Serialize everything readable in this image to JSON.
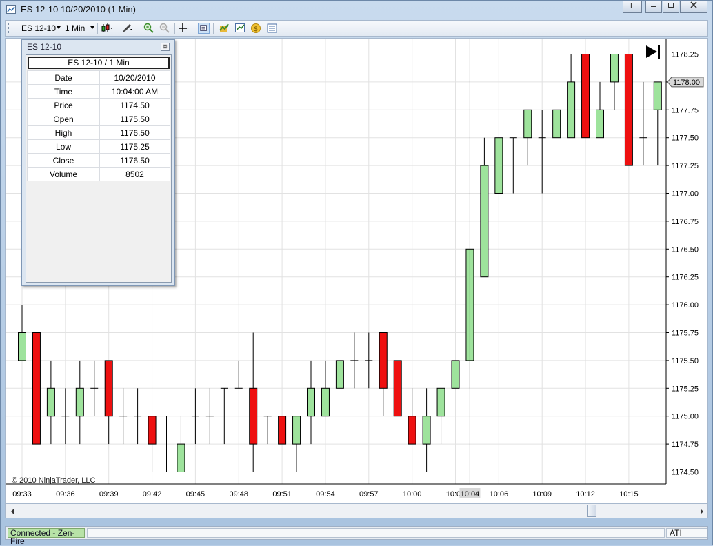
{
  "window": {
    "title": "ES 12-10  10/20/2010 (1 Min)",
    "min_label": "L",
    "buttons": [
      "minimize",
      "maximize",
      "close"
    ]
  },
  "toolbar": {
    "instrument": "ES 12-10",
    "period": "1 Min"
  },
  "data_box": {
    "title": "ES 12-10",
    "header": "ES 12-10 / 1 Min",
    "rows": [
      {
        "label": "Date",
        "value": "10/20/2010"
      },
      {
        "label": "Time",
        "value": "10:04:00 AM"
      },
      {
        "label": "Price",
        "value": "1174.50"
      },
      {
        "label": "Open",
        "value": "1175.50"
      },
      {
        "label": "High",
        "value": "1176.50"
      },
      {
        "label": "Low",
        "value": "1175.25"
      },
      {
        "label": "Close",
        "value": "1176.50"
      },
      {
        "label": "Volume",
        "value": "8502"
      }
    ]
  },
  "copyright": "© 2010 NinjaTrader, LLC",
  "status": {
    "connection": "Connected - Zen-Fire",
    "provider": "ATI"
  },
  "colors": {
    "up": "#9ee39c",
    "down": "#ee1010",
    "grid": "#e2e2e2",
    "current_price_bg": "#d8d8d8"
  },
  "chart_data": {
    "type": "candlestick",
    "instrument": "ES 12-10",
    "interval": "1 Min",
    "ylim": [
      1174.5,
      1178.25
    ],
    "yticks": [
      "1178.25",
      "1178.00",
      "1177.75",
      "1177.50",
      "1177.25",
      "1177.00",
      "1176.75",
      "1176.50",
      "1176.25",
      "1176.00",
      "1175.75",
      "1175.50",
      "1175.25",
      "1175.00",
      "1174.75",
      "1174.50"
    ],
    "xticks": [
      "09:33",
      "09:36",
      "09:39",
      "09:42",
      "09:45",
      "09:48",
      "09:51",
      "09:54",
      "09:57",
      "10:00",
      "10:03",
      "10:06",
      "10:09",
      "10:12",
      "10:15"
    ],
    "crosshair_time": "10:04",
    "current_price": "1178.00",
    "candles": [
      {
        "time": "09:33",
        "o": 1175.5,
        "h": 1176.0,
        "l": 1175.5,
        "c": 1175.75
      },
      {
        "time": "09:34",
        "o": 1175.75,
        "h": 1175.75,
        "l": 1174.75,
        "c": 1174.75
      },
      {
        "time": "09:35",
        "o": 1175.0,
        "h": 1175.5,
        "l": 1174.75,
        "c": 1175.25
      },
      {
        "time": "09:36",
        "o": 1175.0,
        "h": 1175.25,
        "l": 1174.75,
        "c": 1175.0
      },
      {
        "time": "09:37",
        "o": 1175.0,
        "h": 1175.5,
        "l": 1174.75,
        "c": 1175.25
      },
      {
        "time": "09:38",
        "o": 1175.25,
        "h": 1175.5,
        "l": 1175.0,
        "c": 1175.25
      },
      {
        "time": "09:39",
        "o": 1175.5,
        "h": 1175.5,
        "l": 1174.75,
        "c": 1175.0
      },
      {
        "time": "09:40",
        "o": 1175.0,
        "h": 1175.25,
        "l": 1174.75,
        "c": 1175.0
      },
      {
        "time": "09:41",
        "o": 1175.0,
        "h": 1175.25,
        "l": 1174.75,
        "c": 1175.0
      },
      {
        "time": "09:42",
        "o": 1175.0,
        "h": 1175.0,
        "l": 1174.5,
        "c": 1174.75
      },
      {
        "time": "09:43",
        "o": 1174.5,
        "h": 1175.0,
        "l": 1174.5,
        "c": 1174.5
      },
      {
        "time": "09:44",
        "o": 1174.5,
        "h": 1175.0,
        "l": 1174.5,
        "c": 1174.75
      },
      {
        "time": "09:45",
        "o": 1175.0,
        "h": 1175.25,
        "l": 1174.75,
        "c": 1175.0
      },
      {
        "time": "09:46",
        "o": 1175.0,
        "h": 1175.25,
        "l": 1174.75,
        "c": 1175.0
      },
      {
        "time": "09:47",
        "o": 1175.25,
        "h": 1175.25,
        "l": 1174.75,
        "c": 1175.25
      },
      {
        "time": "09:48",
        "o": 1175.25,
        "h": 1175.5,
        "l": 1175.25,
        "c": 1175.25
      },
      {
        "time": "09:49",
        "o": 1175.25,
        "h": 1175.75,
        "l": 1174.5,
        "c": 1174.75
      },
      {
        "time": "09:50",
        "o": 1175.0,
        "h": 1175.0,
        "l": 1174.75,
        "c": 1175.0
      },
      {
        "time": "09:51",
        "o": 1175.0,
        "h": 1175.0,
        "l": 1174.75,
        "c": 1174.75
      },
      {
        "time": "09:52",
        "o": 1174.75,
        "h": 1175.0,
        "l": 1174.5,
        "c": 1175.0
      },
      {
        "time": "09:53",
        "o": 1175.0,
        "h": 1175.5,
        "l": 1174.75,
        "c": 1175.25
      },
      {
        "time": "09:54",
        "o": 1175.0,
        "h": 1175.5,
        "l": 1175.0,
        "c": 1175.25
      },
      {
        "time": "09:55",
        "o": 1175.25,
        "h": 1175.5,
        "l": 1175.25,
        "c": 1175.5
      },
      {
        "time": "09:56",
        "o": 1175.5,
        "h": 1175.75,
        "l": 1175.25,
        "c": 1175.5
      },
      {
        "time": "09:57",
        "o": 1175.5,
        "h": 1175.75,
        "l": 1175.25,
        "c": 1175.5
      },
      {
        "time": "09:58",
        "o": 1175.75,
        "h": 1175.75,
        "l": 1175.0,
        "c": 1175.25
      },
      {
        "time": "09:59",
        "o": 1175.5,
        "h": 1175.5,
        "l": 1175.0,
        "c": 1175.0
      },
      {
        "time": "10:00",
        "o": 1175.0,
        "h": 1175.25,
        "l": 1174.75,
        "c": 1174.75
      },
      {
        "time": "10:01",
        "o": 1174.75,
        "h": 1175.25,
        "l": 1174.5,
        "c": 1175.0
      },
      {
        "time": "10:02",
        "o": 1175.0,
        "h": 1175.25,
        "l": 1174.75,
        "c": 1175.25
      },
      {
        "time": "10:03",
        "o": 1175.25,
        "h": 1175.5,
        "l": 1175.25,
        "c": 1175.5
      },
      {
        "time": "10:04",
        "o": 1175.5,
        "h": 1176.5,
        "l": 1175.25,
        "c": 1176.5
      },
      {
        "time": "10:05",
        "o": 1176.25,
        "h": 1177.5,
        "l": 1176.25,
        "c": 1177.25
      },
      {
        "time": "10:06",
        "o": 1177.0,
        "h": 1177.5,
        "l": 1177.0,
        "c": 1177.5
      },
      {
        "time": "10:07",
        "o": 1177.5,
        "h": 1177.5,
        "l": 1177.0,
        "c": 1177.5
      },
      {
        "time": "10:08",
        "o": 1177.5,
        "h": 1177.75,
        "l": 1177.25,
        "c": 1177.75
      },
      {
        "time": "10:09",
        "o": 1177.5,
        "h": 1177.75,
        "l": 1177.0,
        "c": 1177.5
      },
      {
        "time": "10:10",
        "o": 1177.5,
        "h": 1177.75,
        "l": 1177.5,
        "c": 1177.75
      },
      {
        "time": "10:11",
        "o": 1177.5,
        "h": 1178.25,
        "l": 1177.5,
        "c": 1178.0
      },
      {
        "time": "10:12",
        "o": 1178.25,
        "h": 1178.25,
        "l": 1177.5,
        "c": 1177.5
      },
      {
        "time": "10:13",
        "o": 1177.5,
        "h": 1178.0,
        "l": 1177.5,
        "c": 1177.75
      },
      {
        "time": "10:14",
        "o": 1178.0,
        "h": 1178.25,
        "l": 1177.75,
        "c": 1178.25
      },
      {
        "time": "10:15",
        "o": 1178.25,
        "h": 1178.25,
        "l": 1177.25,
        "c": 1177.25
      },
      {
        "time": "10:16",
        "o": 1177.5,
        "h": 1178.0,
        "l": 1177.25,
        "c": 1177.5
      },
      {
        "time": "10:17",
        "o": 1177.75,
        "h": 1178.0,
        "l": 1177.25,
        "c": 1178.0
      }
    ]
  }
}
